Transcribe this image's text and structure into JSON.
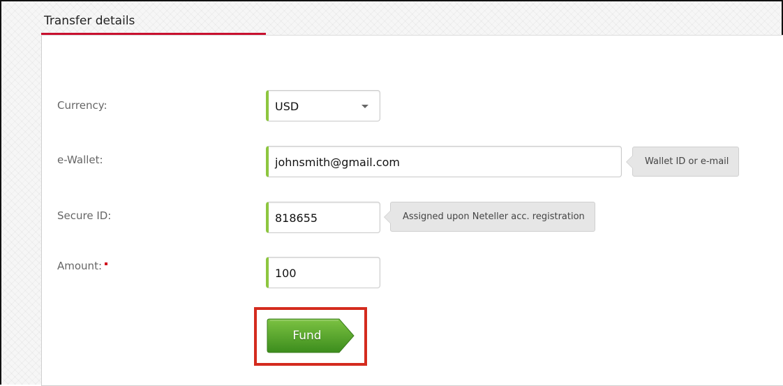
{
  "section": {
    "title": "Transfer details"
  },
  "form": {
    "currency": {
      "label": "Currency:",
      "value": "USD"
    },
    "ewallet": {
      "label": "e-Wallet:",
      "value": "johnsmith@gmail.com",
      "hint": "Wallet ID or e-mail"
    },
    "secure_id": {
      "label": "Secure ID:",
      "value": "818655",
      "hint": "Assigned upon Neteller acc. registration"
    },
    "amount": {
      "label": "Amount:",
      "value": "100",
      "required": true
    },
    "submit_label": "Fund"
  },
  "colors": {
    "accent_red": "#c8102e",
    "input_accent_green": "#8dc63f",
    "button_green_top": "#7cc242",
    "button_green_bottom": "#3c8d1d",
    "highlight_red": "#d42b1e"
  }
}
